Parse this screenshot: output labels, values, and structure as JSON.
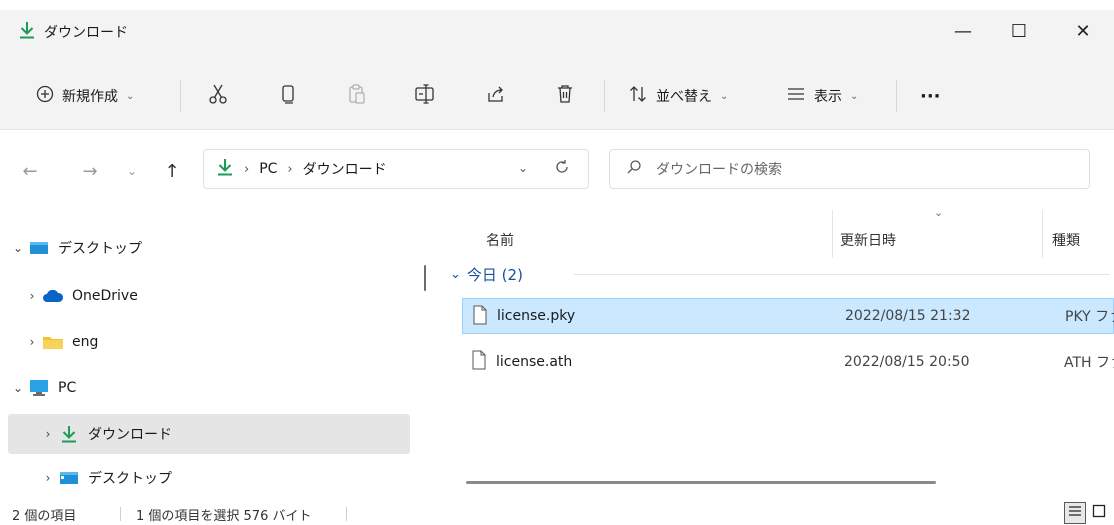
{
  "window": {
    "title": "ダウンロード",
    "minimize": "—",
    "maximize": "☐",
    "close": "✕"
  },
  "toolbar": {
    "new_label": "新規作成",
    "sort_label": "並べ替え",
    "view_label": "表示",
    "more_label": "···"
  },
  "address": {
    "crumbs": [
      "PC",
      "ダウンロード"
    ]
  },
  "search": {
    "placeholder": "ダウンロードの検索"
  },
  "sidebar": {
    "items": [
      {
        "label": "デスクトップ",
        "expanded": true
      },
      {
        "label": "OneDrive",
        "expanded": false
      },
      {
        "label": "eng",
        "expanded": false
      },
      {
        "label": "PC",
        "expanded": true
      },
      {
        "label": "ダウンロード",
        "expanded": false,
        "selected": true
      },
      {
        "label": "デスクトップ",
        "expanded": false
      }
    ]
  },
  "columns": {
    "name": "名前",
    "modified": "更新日時",
    "type": "種類"
  },
  "group": {
    "label": "今日 (2)"
  },
  "files": [
    {
      "name": "license.pky",
      "date": "2022/08/15 21:32",
      "type": "PKY ファイル",
      "selected": true
    },
    {
      "name": "license.ath",
      "date": "2022/08/15 20:50",
      "type": "ATH ファイル",
      "selected": false
    }
  ],
  "status": {
    "count": "2 個の項目",
    "selection": "1 個の項目を選択  576 バイト"
  },
  "colors": {
    "download_green": "#1e9b54",
    "folder_yellow": "#f2c230",
    "onedrive_blue": "#0a64c8",
    "selection_bg": "#cce8ff"
  }
}
